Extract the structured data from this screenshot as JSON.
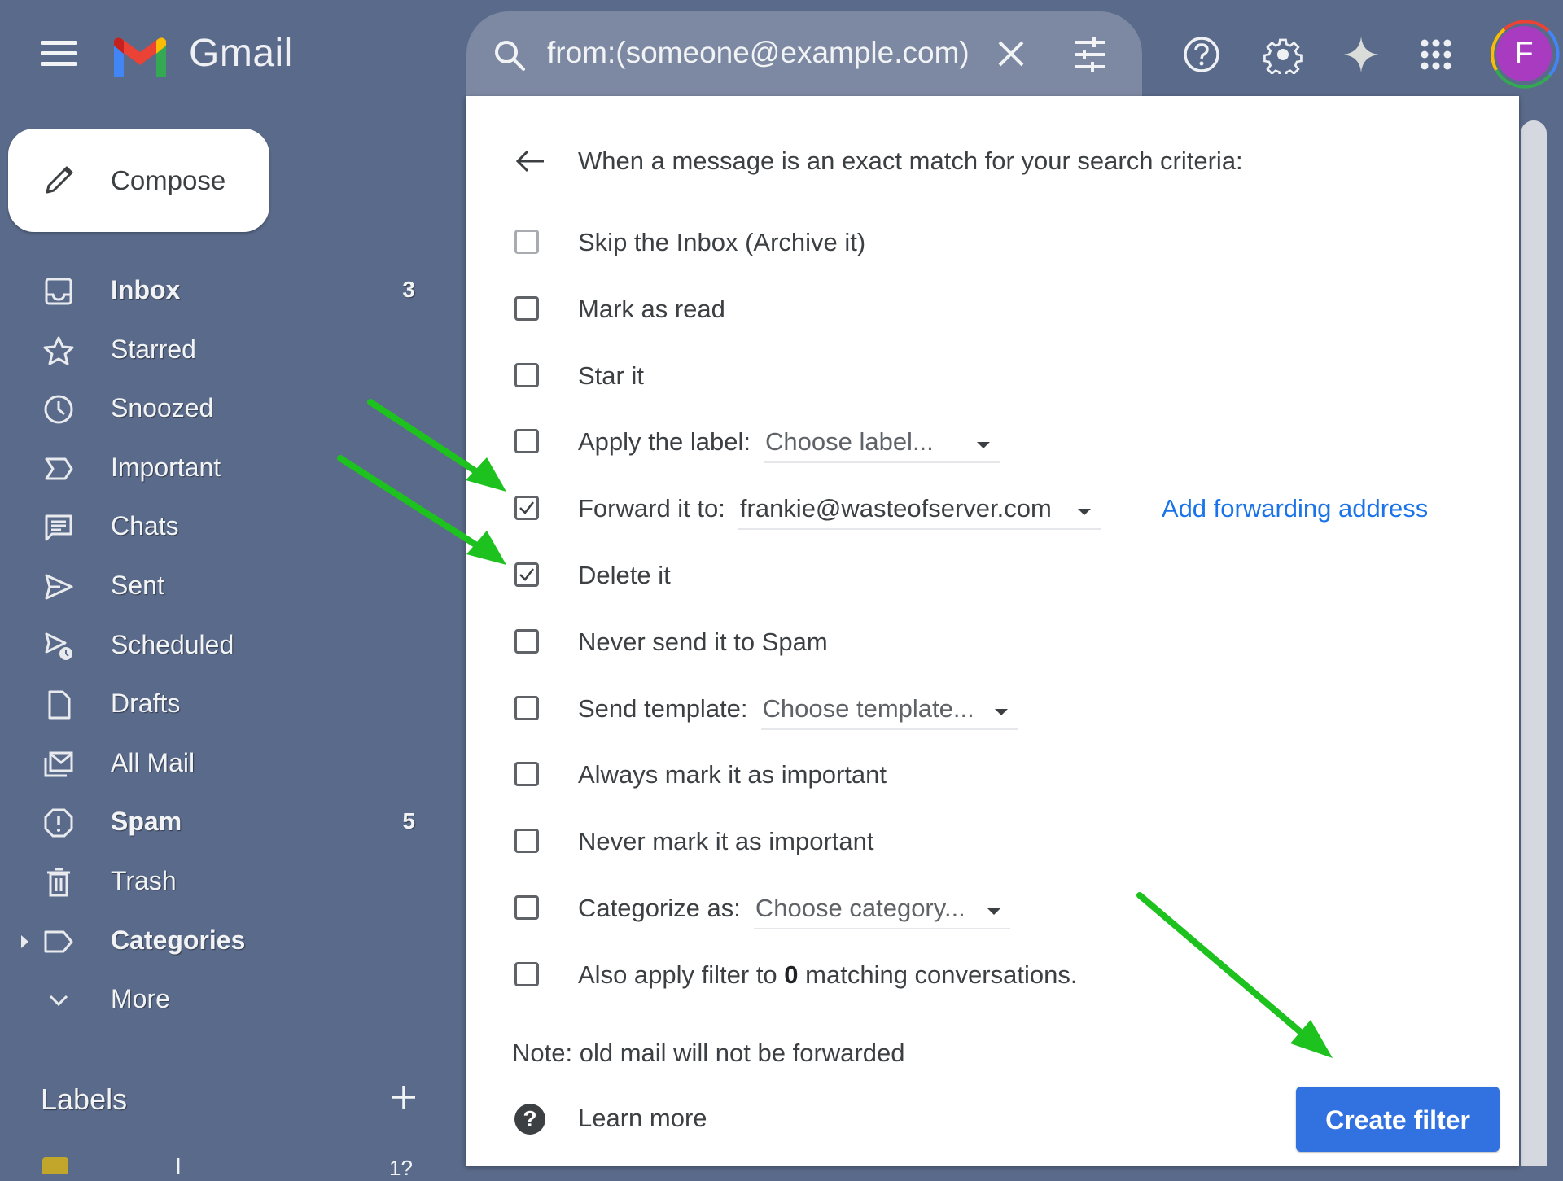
{
  "header": {
    "app_name": "Gmail",
    "search_value": "from:(someone@example.com)",
    "avatar_initial": "F",
    "icons": [
      "menu-icon",
      "search-icon",
      "clear-icon",
      "search-options-icon",
      "help-icon",
      "settings-icon",
      "gemini-icon",
      "apps-icon"
    ]
  },
  "compose": {
    "label": "Compose"
  },
  "sidebar": {
    "items": [
      {
        "label": "Inbox",
        "count": "3",
        "bold": true,
        "icon": "inbox-icon"
      },
      {
        "label": "Starred",
        "count": "",
        "bold": false,
        "icon": "star-icon"
      },
      {
        "label": "Snoozed",
        "count": "",
        "bold": false,
        "icon": "clock-icon"
      },
      {
        "label": "Important",
        "count": "",
        "bold": false,
        "icon": "important-icon"
      },
      {
        "label": "Chats",
        "count": "",
        "bold": false,
        "icon": "chat-icon"
      },
      {
        "label": "Sent",
        "count": "",
        "bold": false,
        "icon": "send-icon"
      },
      {
        "label": "Scheduled",
        "count": "",
        "bold": false,
        "icon": "scheduled-send-icon"
      },
      {
        "label": "Drafts",
        "count": "",
        "bold": false,
        "icon": "draft-icon"
      },
      {
        "label": "All Mail",
        "count": "",
        "bold": false,
        "icon": "all-mail-icon"
      },
      {
        "label": "Spam",
        "count": "5",
        "bold": true,
        "icon": "spam-icon"
      },
      {
        "label": "Trash",
        "count": "",
        "bold": false,
        "icon": "trash-icon"
      },
      {
        "label": "Categories",
        "count": "",
        "bold": true,
        "icon": "label-icon"
      },
      {
        "label": "More",
        "count": "",
        "bold": false,
        "icon": "chevron-down-icon"
      }
    ],
    "labels_title": "Labels",
    "label_partial_text": "l",
    "label_partial_count": "1?",
    "label_color": "#c2a52b"
  },
  "filter_panel": {
    "criteria_text": "When a message is an exact match for your search criteria:",
    "options": [
      {
        "label": "Skip the Inbox (Archive it)",
        "checked": false
      },
      {
        "label": "Mark as read",
        "checked": false
      },
      {
        "label": "Star it",
        "checked": false
      },
      {
        "label": "Apply the label:",
        "checked": false,
        "dropdown": "Choose label..."
      },
      {
        "label": "Forward it to:",
        "checked": true,
        "dropdown": "frankie@wasteofserver.com",
        "link": "Add forwarding address"
      },
      {
        "label": "Delete it",
        "checked": true
      },
      {
        "label": "Never send it to Spam",
        "checked": false
      },
      {
        "label": "Send template:",
        "checked": false,
        "dropdown": "Choose template..."
      },
      {
        "label": "Always mark it as important",
        "checked": false
      },
      {
        "label": "Never mark it as important",
        "checked": false
      },
      {
        "label": "Categorize as:",
        "checked": false,
        "dropdown": "Choose category..."
      },
      {
        "label_prefix": "Also apply filter to ",
        "label_count": "0",
        "label_suffix": " matching conversations.",
        "checked": false
      }
    ],
    "note": "Note: old mail will not be forwarded",
    "learn_more": "Learn more",
    "create_button": "Create filter"
  },
  "colors": {
    "background": "#5a6a8a",
    "search_bar": "#7d89a3",
    "accent_blue": "#3271e0",
    "link_blue": "#1a73e8",
    "avatar": "#a93bc1",
    "annotation_arrow": "#1ec21e"
  }
}
